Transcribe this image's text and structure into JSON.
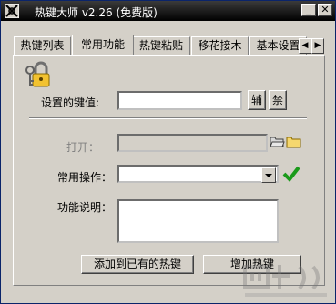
{
  "window": {
    "title": "热键大师  v2.26 (免费版)",
    "minimize_glyph": "_",
    "close_glyph": "✕"
  },
  "tabs": [
    {
      "label": "热键列表",
      "active": false
    },
    {
      "label": "常用功能",
      "active": true
    },
    {
      "label": "热键粘贴",
      "active": false
    },
    {
      "label": "移花接木",
      "active": false
    },
    {
      "label": "基本设置",
      "active": false
    }
  ],
  "tab_scroll": {
    "left_glyph": "◀",
    "right_glyph": "▶"
  },
  "form": {
    "key_value_label": "设置的键值:",
    "key_value": "",
    "assist_button": "辅",
    "forbid_button": "禁",
    "open_label": "打开：",
    "open_value": "",
    "common_op_label": "常用操作：",
    "common_op_value": "",
    "description_label": "功能说明：",
    "description_value": ""
  },
  "actions": {
    "add_existing": "添加到已有的热键",
    "add_hotkey": "增加热键"
  },
  "icons": {
    "app": "app-icon",
    "lock": "lock-keys-icon",
    "browse": "open-folder-icon",
    "folder": "folder-icon",
    "confirm": "check-icon",
    "check_color": "#1a9a1a",
    "folder_color": "#f5d76e"
  }
}
